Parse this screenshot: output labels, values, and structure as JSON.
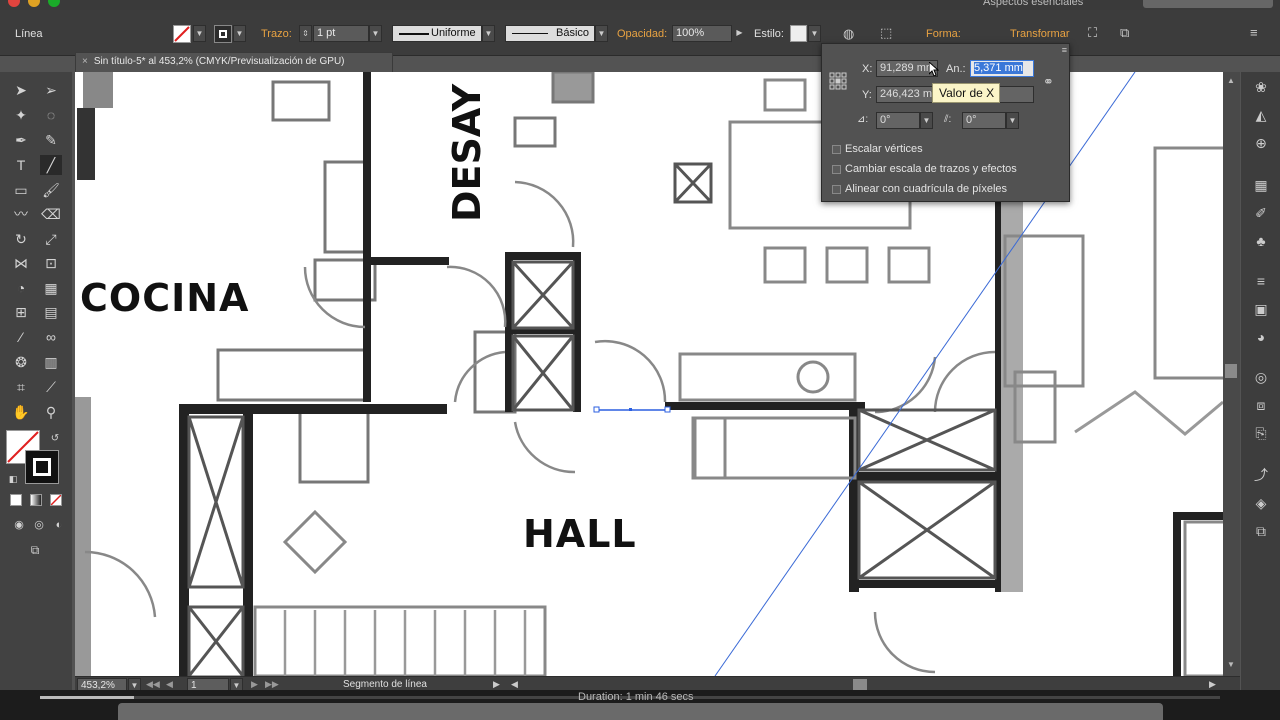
{
  "window": {
    "workspace_label": "Aspectos esenciales"
  },
  "control_bar": {
    "selection_type": "Línea",
    "stroke_label": "Trazo:",
    "stroke_weight": "1 pt",
    "profile_uniform": "Uniforme",
    "brush_basic": "Básico",
    "opacity_label": "Opacidad:",
    "opacity_value": "100%",
    "style_label": "Estilo:",
    "shape_label": "Forma:",
    "transform_label": "Transformar"
  },
  "document": {
    "tab_title": "Sin título-5* al 453,2% (CMYK/Previsualización de GPU)"
  },
  "floor_plan": {
    "labels": {
      "cocina": "COCINA",
      "hall": "HALL",
      "desay": "DESAY"
    }
  },
  "transform_panel": {
    "x_label": "X:",
    "x_value": "91,289 mm",
    "w_label": "An.:",
    "w_value": "5,371 mm",
    "y_label": "Y:",
    "y_value": "246,423 mm",
    "angle_value": "0°",
    "shear_value": "0°",
    "options": [
      {
        "label": "Escalar vértices",
        "checked": false
      },
      {
        "label": "Cambiar escala de trazos y efectos",
        "checked": false
      },
      {
        "label": "Alinear con cuadrícula de píxeles",
        "checked": false
      }
    ],
    "tooltip": "Valor de X"
  },
  "status_bar": {
    "zoom": "453,2%",
    "artboard": "1",
    "tool_status": "Segmento de línea"
  },
  "video": {
    "duration": "Duration: 1 min 46 secs",
    "progress": 0.08
  },
  "colors": {
    "accent_orange": "#e8a242",
    "selection_blue": "#3b78d8",
    "panel_bg": "#525252"
  }
}
